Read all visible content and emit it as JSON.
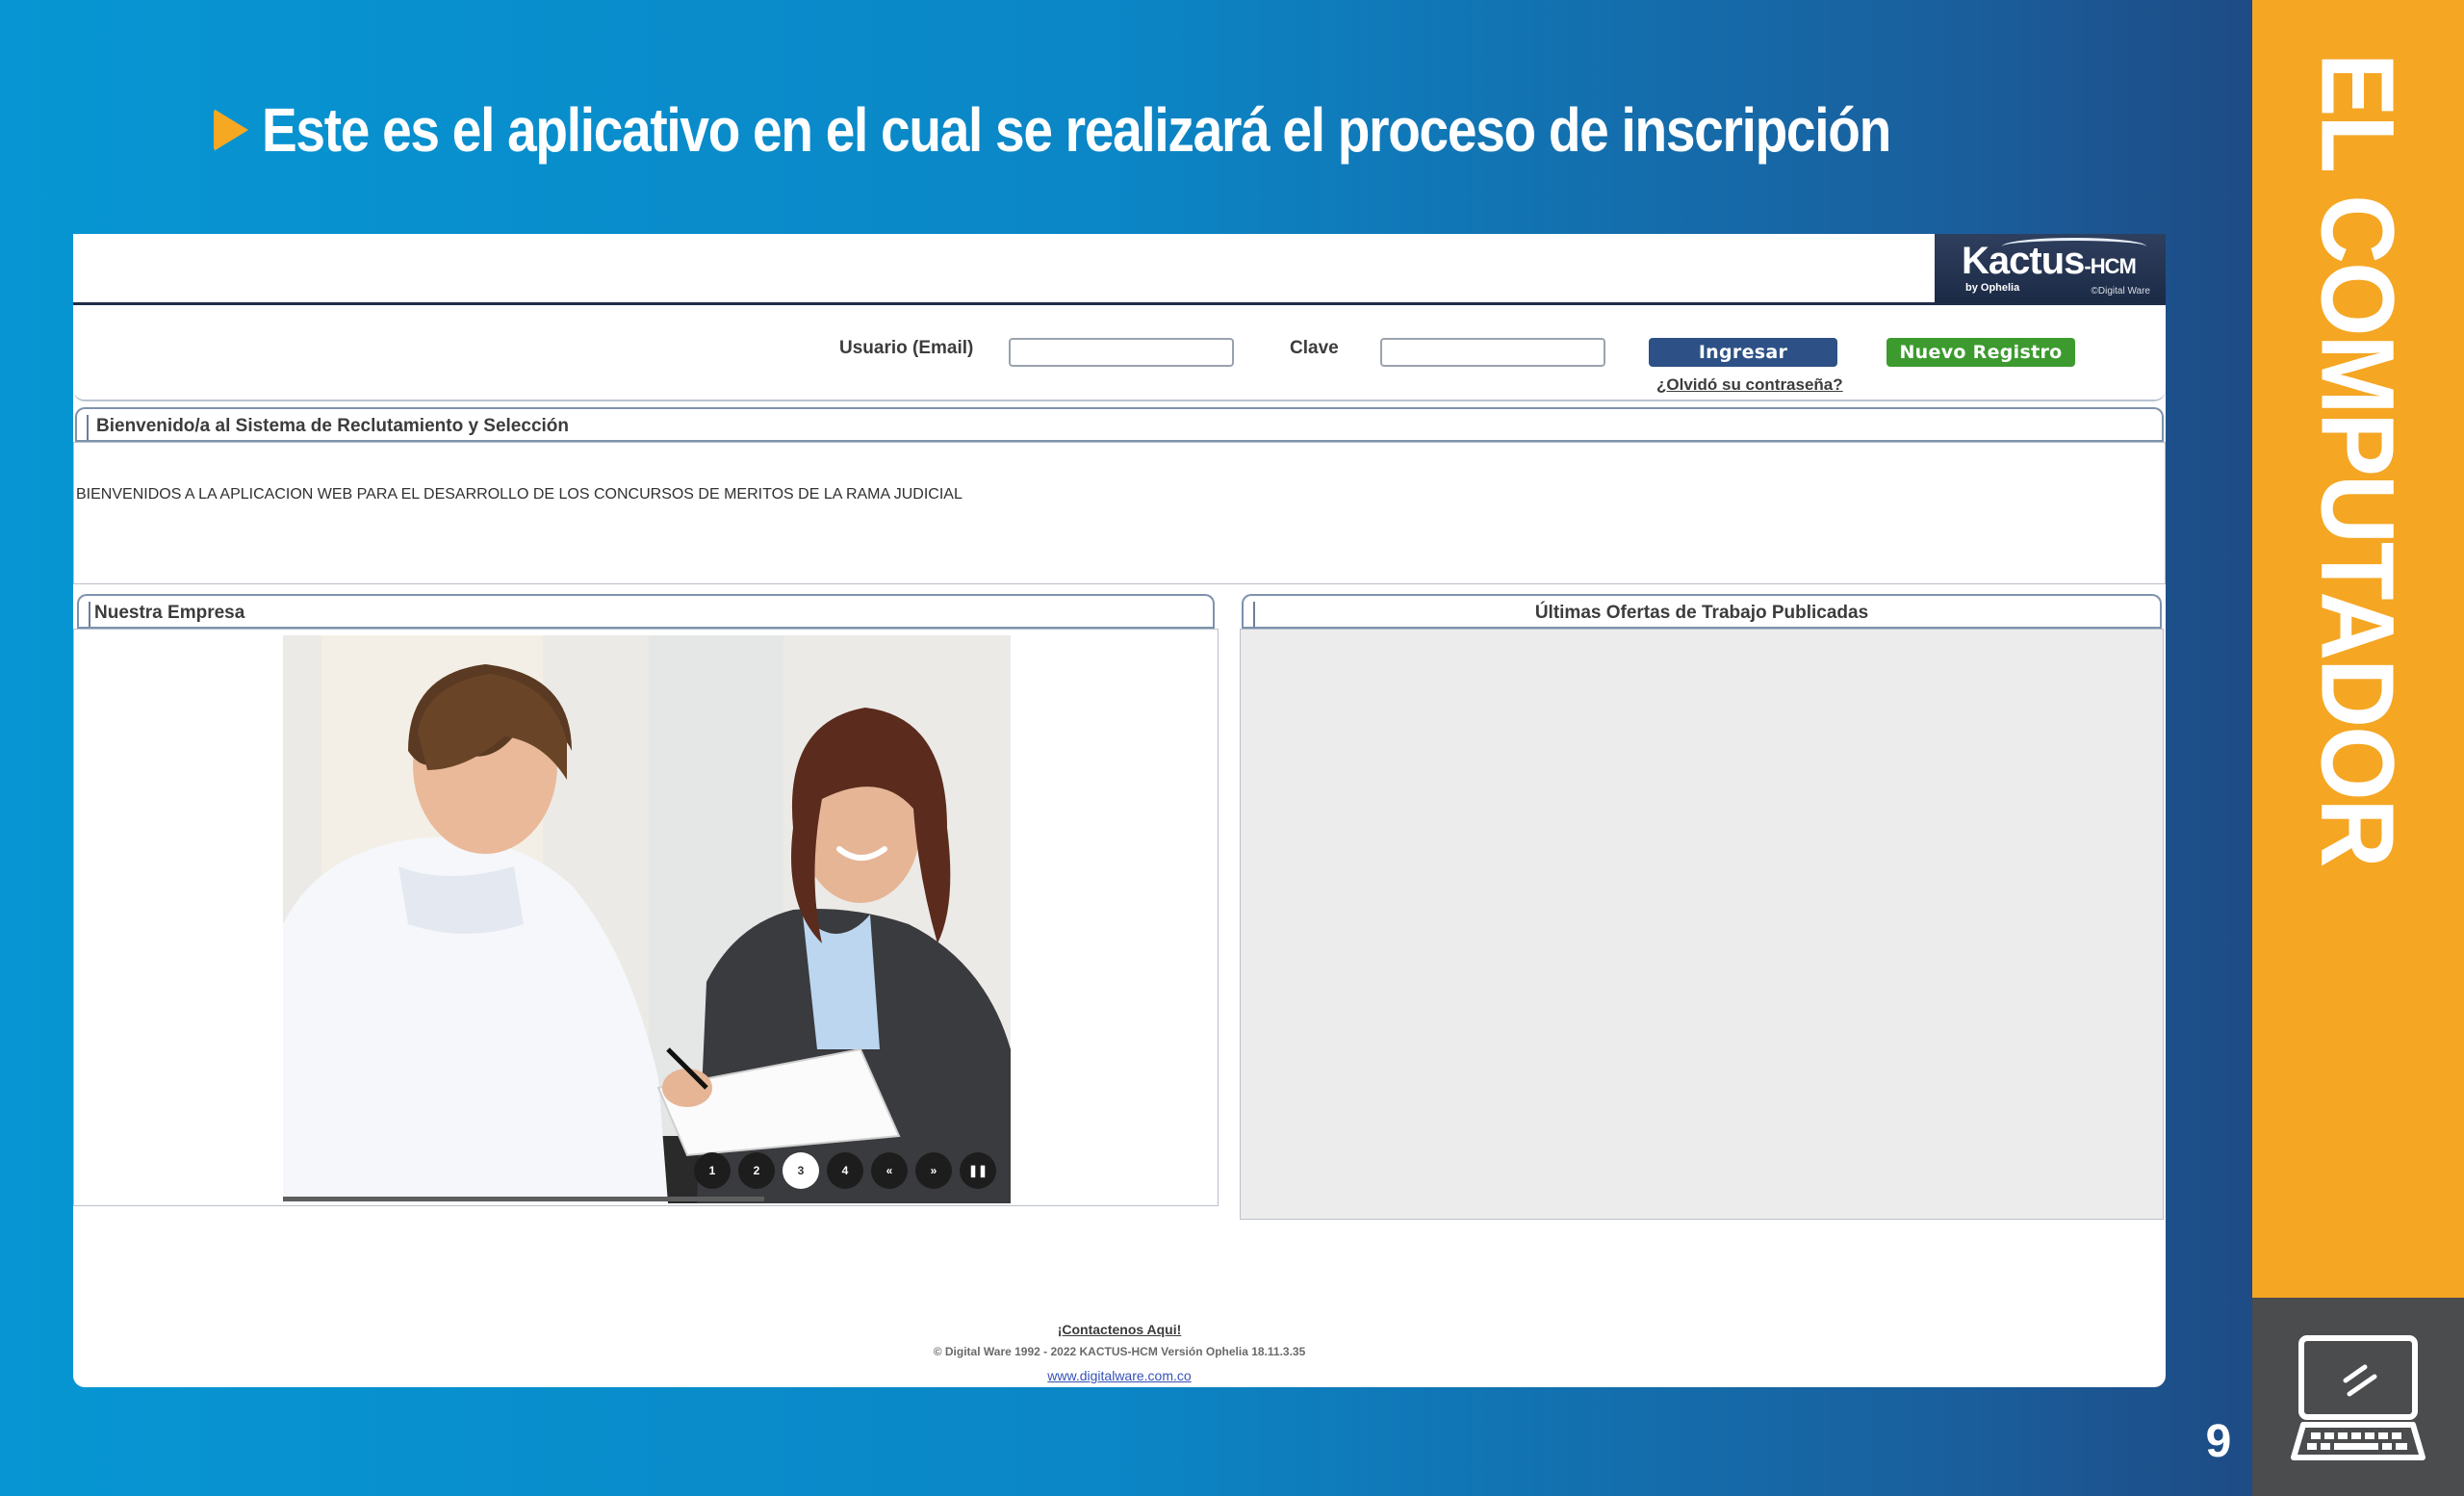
{
  "slide": {
    "title": "Este es el aplicativo en el cual se realizará el proceso de inscripción",
    "side_label": "EL COMPUTADOR",
    "page_number": "9",
    "accent_color": "#f5a623",
    "title_icon": "play-triangle-icon",
    "footer_icon": "computer-icon"
  },
  "app": {
    "logo": {
      "main": "Kactus",
      "suffix": "-HCM",
      "sub": "by Ophelia",
      "copyright": "©Digital Ware"
    },
    "login": {
      "user_label": "Usuario (Email)",
      "user_value": "",
      "password_label": "Clave",
      "password_value": "",
      "login_button": "Ingresar",
      "register_button": "Nuevo Registro",
      "forgot_link": "¿Olvidó su contraseña?"
    },
    "welcome": {
      "header": "Bienvenido/a al Sistema de Reclutamiento y Selección",
      "text": "BIENVENIDOS A LA APLICACION WEB PARA EL DESARROLLO DE LOS CONCURSOS DE MERITOS DE LA RAMA JUDICIAL"
    },
    "company": {
      "header": "Nuestra Empresa",
      "slider": {
        "pages": [
          "1",
          "2",
          "3",
          "4"
        ],
        "active_page": "3",
        "prev": "«",
        "next": "»",
        "pause": "❚❚"
      }
    },
    "offers": {
      "header": "Últimas Ofertas de Trabajo Publicadas"
    },
    "footer": {
      "contact": "¡Contactenos Aqui!",
      "copyright": "© Digital Ware 1992 - 2022 KACTUS-HCM Versión Ophelia 18.11.3.35",
      "url": "www.digitalware.com.co"
    }
  }
}
